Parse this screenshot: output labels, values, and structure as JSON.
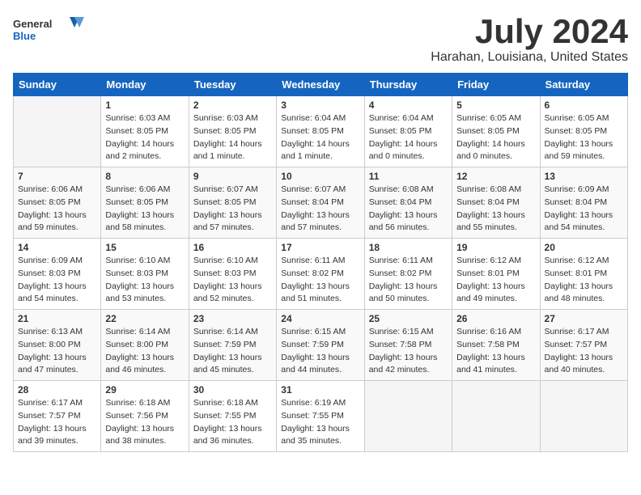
{
  "header": {
    "logo_general": "General",
    "logo_blue": "Blue",
    "title": "July 2024",
    "location": "Harahan, Louisiana, United States"
  },
  "days_of_week": [
    "Sunday",
    "Monday",
    "Tuesday",
    "Wednesday",
    "Thursday",
    "Friday",
    "Saturday"
  ],
  "weeks": [
    [
      {
        "day": "",
        "sunrise": "",
        "sunset": "",
        "daylight": ""
      },
      {
        "day": "1",
        "sunrise": "Sunrise: 6:03 AM",
        "sunset": "Sunset: 8:05 PM",
        "daylight": "Daylight: 14 hours and 2 minutes."
      },
      {
        "day": "2",
        "sunrise": "Sunrise: 6:03 AM",
        "sunset": "Sunset: 8:05 PM",
        "daylight": "Daylight: 14 hours and 1 minute."
      },
      {
        "day": "3",
        "sunrise": "Sunrise: 6:04 AM",
        "sunset": "Sunset: 8:05 PM",
        "daylight": "Daylight: 14 hours and 1 minute."
      },
      {
        "day": "4",
        "sunrise": "Sunrise: 6:04 AM",
        "sunset": "Sunset: 8:05 PM",
        "daylight": "Daylight: 14 hours and 0 minutes."
      },
      {
        "day": "5",
        "sunrise": "Sunrise: 6:05 AM",
        "sunset": "Sunset: 8:05 PM",
        "daylight": "Daylight: 14 hours and 0 minutes."
      },
      {
        "day": "6",
        "sunrise": "Sunrise: 6:05 AM",
        "sunset": "Sunset: 8:05 PM",
        "daylight": "Daylight: 13 hours and 59 minutes."
      }
    ],
    [
      {
        "day": "7",
        "sunrise": "Sunrise: 6:06 AM",
        "sunset": "Sunset: 8:05 PM",
        "daylight": "Daylight: 13 hours and 59 minutes."
      },
      {
        "day": "8",
        "sunrise": "Sunrise: 6:06 AM",
        "sunset": "Sunset: 8:05 PM",
        "daylight": "Daylight: 13 hours and 58 minutes."
      },
      {
        "day": "9",
        "sunrise": "Sunrise: 6:07 AM",
        "sunset": "Sunset: 8:05 PM",
        "daylight": "Daylight: 13 hours and 57 minutes."
      },
      {
        "day": "10",
        "sunrise": "Sunrise: 6:07 AM",
        "sunset": "Sunset: 8:04 PM",
        "daylight": "Daylight: 13 hours and 57 minutes."
      },
      {
        "day": "11",
        "sunrise": "Sunrise: 6:08 AM",
        "sunset": "Sunset: 8:04 PM",
        "daylight": "Daylight: 13 hours and 56 minutes."
      },
      {
        "day": "12",
        "sunrise": "Sunrise: 6:08 AM",
        "sunset": "Sunset: 8:04 PM",
        "daylight": "Daylight: 13 hours and 55 minutes."
      },
      {
        "day": "13",
        "sunrise": "Sunrise: 6:09 AM",
        "sunset": "Sunset: 8:04 PM",
        "daylight": "Daylight: 13 hours and 54 minutes."
      }
    ],
    [
      {
        "day": "14",
        "sunrise": "Sunrise: 6:09 AM",
        "sunset": "Sunset: 8:03 PM",
        "daylight": "Daylight: 13 hours and 54 minutes."
      },
      {
        "day": "15",
        "sunrise": "Sunrise: 6:10 AM",
        "sunset": "Sunset: 8:03 PM",
        "daylight": "Daylight: 13 hours and 53 minutes."
      },
      {
        "day": "16",
        "sunrise": "Sunrise: 6:10 AM",
        "sunset": "Sunset: 8:03 PM",
        "daylight": "Daylight: 13 hours and 52 minutes."
      },
      {
        "day": "17",
        "sunrise": "Sunrise: 6:11 AM",
        "sunset": "Sunset: 8:02 PM",
        "daylight": "Daylight: 13 hours and 51 minutes."
      },
      {
        "day": "18",
        "sunrise": "Sunrise: 6:11 AM",
        "sunset": "Sunset: 8:02 PM",
        "daylight": "Daylight: 13 hours and 50 minutes."
      },
      {
        "day": "19",
        "sunrise": "Sunrise: 6:12 AM",
        "sunset": "Sunset: 8:01 PM",
        "daylight": "Daylight: 13 hours and 49 minutes."
      },
      {
        "day": "20",
        "sunrise": "Sunrise: 6:12 AM",
        "sunset": "Sunset: 8:01 PM",
        "daylight": "Daylight: 13 hours and 48 minutes."
      }
    ],
    [
      {
        "day": "21",
        "sunrise": "Sunrise: 6:13 AM",
        "sunset": "Sunset: 8:00 PM",
        "daylight": "Daylight: 13 hours and 47 minutes."
      },
      {
        "day": "22",
        "sunrise": "Sunrise: 6:14 AM",
        "sunset": "Sunset: 8:00 PM",
        "daylight": "Daylight: 13 hours and 46 minutes."
      },
      {
        "day": "23",
        "sunrise": "Sunrise: 6:14 AM",
        "sunset": "Sunset: 7:59 PM",
        "daylight": "Daylight: 13 hours and 45 minutes."
      },
      {
        "day": "24",
        "sunrise": "Sunrise: 6:15 AM",
        "sunset": "Sunset: 7:59 PM",
        "daylight": "Daylight: 13 hours and 44 minutes."
      },
      {
        "day": "25",
        "sunrise": "Sunrise: 6:15 AM",
        "sunset": "Sunset: 7:58 PM",
        "daylight": "Daylight: 13 hours and 42 minutes."
      },
      {
        "day": "26",
        "sunrise": "Sunrise: 6:16 AM",
        "sunset": "Sunset: 7:58 PM",
        "daylight": "Daylight: 13 hours and 41 minutes."
      },
      {
        "day": "27",
        "sunrise": "Sunrise: 6:17 AM",
        "sunset": "Sunset: 7:57 PM",
        "daylight": "Daylight: 13 hours and 40 minutes."
      }
    ],
    [
      {
        "day": "28",
        "sunrise": "Sunrise: 6:17 AM",
        "sunset": "Sunset: 7:57 PM",
        "daylight": "Daylight: 13 hours and 39 minutes."
      },
      {
        "day": "29",
        "sunrise": "Sunrise: 6:18 AM",
        "sunset": "Sunset: 7:56 PM",
        "daylight": "Daylight: 13 hours and 38 minutes."
      },
      {
        "day": "30",
        "sunrise": "Sunrise: 6:18 AM",
        "sunset": "Sunset: 7:55 PM",
        "daylight": "Daylight: 13 hours and 36 minutes."
      },
      {
        "day": "31",
        "sunrise": "Sunrise: 6:19 AM",
        "sunset": "Sunset: 7:55 PM",
        "daylight": "Daylight: 13 hours and 35 minutes."
      },
      {
        "day": "",
        "sunrise": "",
        "sunset": "",
        "daylight": ""
      },
      {
        "day": "",
        "sunrise": "",
        "sunset": "",
        "daylight": ""
      },
      {
        "day": "",
        "sunrise": "",
        "sunset": "",
        "daylight": ""
      }
    ]
  ]
}
